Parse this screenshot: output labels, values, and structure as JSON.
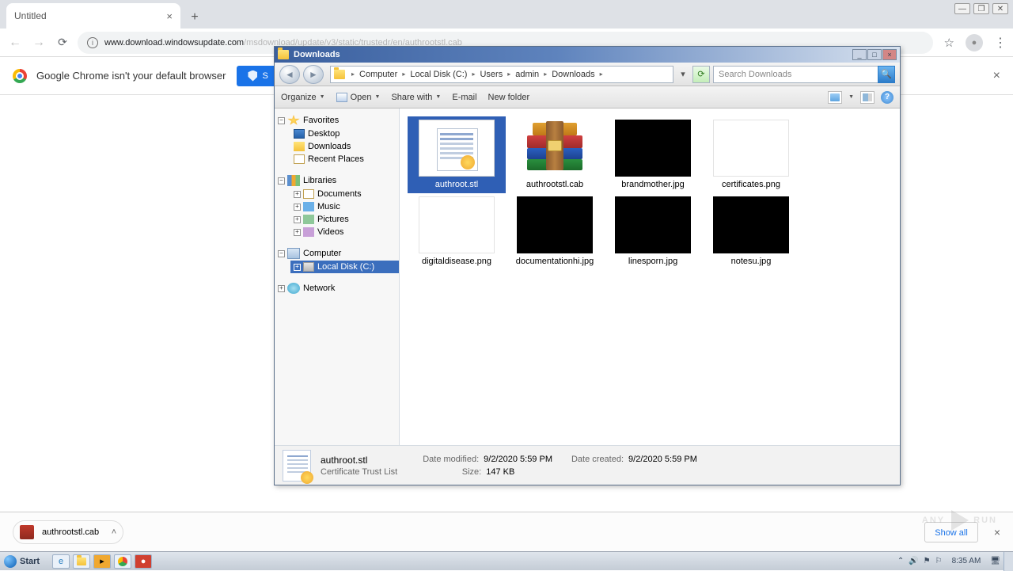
{
  "chrome": {
    "tab_title": "Untitled",
    "url_host": "www.download.windowsupdate.com",
    "url_path": "/msdownload/update/v3/static/trustedr/en/authrootstl.cab"
  },
  "infobar": {
    "text": "Google Chrome isn't your default browser",
    "button": "S"
  },
  "download_shelf": {
    "item": "authrootstl.cab",
    "show_all": "Show all"
  },
  "explorer": {
    "title": "Downloads",
    "crumbs": [
      "Computer",
      "Local Disk (C:)",
      "Users",
      "admin",
      "Downloads"
    ],
    "search_placeholder": "Search Downloads",
    "toolbar": {
      "organize": "Organize",
      "open": "Open",
      "share": "Share with",
      "email": "E-mail",
      "new_folder": "New folder"
    },
    "sidebar": {
      "favorites": "Favorites",
      "desktop": "Desktop",
      "downloads": "Downloads",
      "recent": "Recent Places",
      "libraries": "Libraries",
      "documents": "Documents",
      "music": "Music",
      "pictures": "Pictures",
      "videos": "Videos",
      "computer": "Computer",
      "local_disk": "Local Disk (C:)",
      "network": "Network"
    },
    "files": [
      {
        "name": "authroot.stl",
        "thumb": "cert",
        "selected": true
      },
      {
        "name": "authrootstl.cab",
        "thumb": "rar"
      },
      {
        "name": "brandmother.jpg",
        "thumb": "black"
      },
      {
        "name": "certificates.png",
        "thumb": "white"
      },
      {
        "name": "digitaldisease.png",
        "thumb": "white"
      },
      {
        "name": "documentationhi.jpg",
        "thumb": "black"
      },
      {
        "name": "linesporn.jpg",
        "thumb": "black"
      },
      {
        "name": "notesu.jpg",
        "thumb": "black"
      }
    ],
    "details": {
      "name": "authroot.stl",
      "type": "Certificate Trust List",
      "modified_lbl": "Date modified:",
      "modified": "9/2/2020 5:59 PM",
      "size_lbl": "Size:",
      "size": "147 KB",
      "created_lbl": "Date created:",
      "created": "9/2/2020 5:59 PM"
    }
  },
  "taskbar": {
    "start": "Start",
    "clock": "8:35 AM"
  },
  "watermark": "ANY      RUN"
}
